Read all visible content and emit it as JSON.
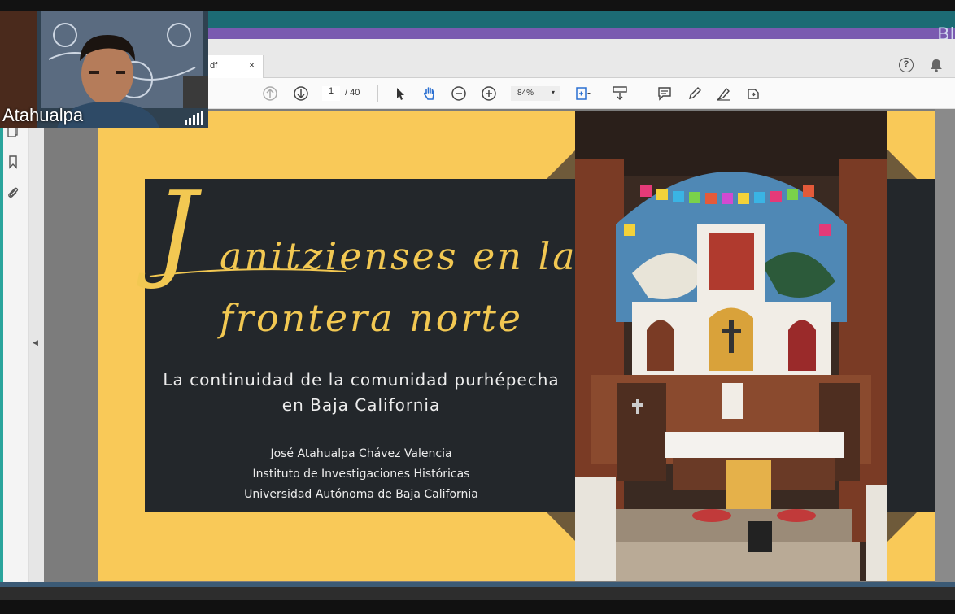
{
  "window": {
    "brand_partial": "Bl"
  },
  "tab": {
    "title": "df",
    "close_glyph": "×"
  },
  "toolbar": {
    "page_current": "1",
    "page_total": "/ 40",
    "zoom": "84%",
    "help_glyph": "?"
  },
  "slide": {
    "title_line1": "anitzienses en la",
    "title_initial": "J",
    "title_line2": "frontera norte",
    "subtitle_line1": "La continuidad de la comunidad purhépecha",
    "subtitle_line2": "en Baja California",
    "author_name": "José Atahualpa Chávez Valencia",
    "institute": "Instituto de Investigaciones Históricas",
    "university": "Universidad Autónoma de Baja California"
  },
  "webcam": {
    "participant_name": "Atahualpa"
  },
  "colors": {
    "slide_background": "#f9c958",
    "panel_dark": "#23272b",
    "title_gold": "#f2c852",
    "accent_purple": "#7a5ab0",
    "accent_teal": "#1c6b74"
  }
}
